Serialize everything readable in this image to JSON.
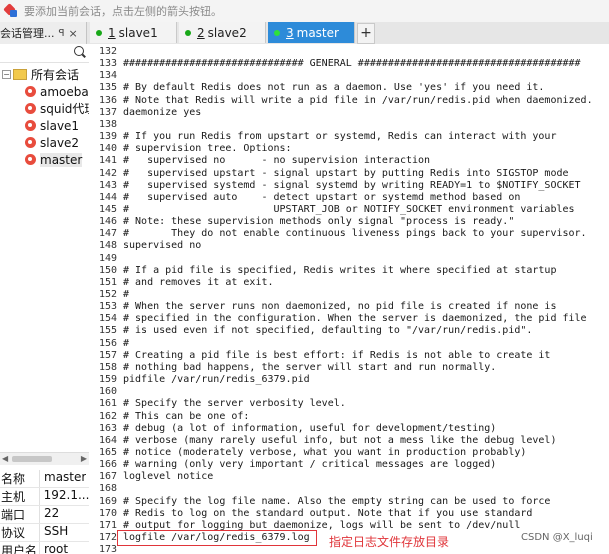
{
  "topbar": {
    "hint": "要添加当前会话，点击左侧的箭头按钮。"
  },
  "panel": {
    "title": "会话管理...",
    "pin": "ꟼ",
    "close": "×"
  },
  "tabs": [
    {
      "num": "1",
      "label": "slave1"
    },
    {
      "num": "2",
      "label": "slave2"
    },
    {
      "num": "3",
      "label": "master"
    }
  ],
  "tab_add": "+",
  "sidebar": {
    "root": "所有会话",
    "sessions": [
      "amoeba",
      "squid代理",
      "slave1",
      "slave2",
      "master"
    ]
  },
  "properties": [
    {
      "k": "名称",
      "v": "master"
    },
    {
      "k": "主机",
      "v": "192.1..."
    },
    {
      "k": "端口",
      "v": "22"
    },
    {
      "k": "协议",
      "v": "SSH"
    },
    {
      "k": "用户名",
      "v": "root"
    }
  ],
  "editor": {
    "lines": [
      {
        "n": "132",
        "t": ""
      },
      {
        "n": "133",
        "t": "############################## GENERAL #####################################"
      },
      {
        "n": "134",
        "t": ""
      },
      {
        "n": "135",
        "t": "# By default Redis does not run as a daemon. Use 'yes' if you need it."
      },
      {
        "n": "136",
        "t": "# Note that Redis will write a pid file in /var/run/redis.pid when daemonized."
      },
      {
        "n": "137",
        "t": "daemonize yes"
      },
      {
        "n": "138",
        "t": ""
      },
      {
        "n": "139",
        "t": "# If you run Redis from upstart or systemd, Redis can interact with your"
      },
      {
        "n": "140",
        "t": "# supervision tree. Options:"
      },
      {
        "n": "141",
        "t": "#   supervised no      - no supervision interaction"
      },
      {
        "n": "142",
        "t": "#   supervised upstart - signal upstart by putting Redis into SIGSTOP mode"
      },
      {
        "n": "143",
        "t": "#   supervised systemd - signal systemd by writing READY=1 to $NOTIFY_SOCKET"
      },
      {
        "n": "144",
        "t": "#   supervised auto    - detect upstart or systemd method based on"
      },
      {
        "n": "145",
        "t": "#                        UPSTART_JOB or NOTIFY_SOCKET environment variables"
      },
      {
        "n": "146",
        "t": "# Note: these supervision methods only signal \"process is ready.\""
      },
      {
        "n": "147",
        "t": "#       They do not enable continuous liveness pings back to your supervisor."
      },
      {
        "n": "148",
        "t": "supervised no"
      },
      {
        "n": "149",
        "t": ""
      },
      {
        "n": "150",
        "t": "# If a pid file is specified, Redis writes it where specified at startup"
      },
      {
        "n": "151",
        "t": "# and removes it at exit."
      },
      {
        "n": "152",
        "t": "#"
      },
      {
        "n": "153",
        "t": "# When the server runs non daemonized, no pid file is created if none is"
      },
      {
        "n": "154",
        "t": "# specified in the configuration. When the server is daemonized, the pid file"
      },
      {
        "n": "155",
        "t": "# is used even if not specified, defaulting to \"/var/run/redis.pid\"."
      },
      {
        "n": "156",
        "t": "#"
      },
      {
        "n": "157",
        "t": "# Creating a pid file is best effort: if Redis is not able to create it"
      },
      {
        "n": "158",
        "t": "# nothing bad happens, the server will start and run normally."
      },
      {
        "n": "159",
        "t": "pidfile /var/run/redis_6379.pid"
      },
      {
        "n": "160",
        "t": ""
      },
      {
        "n": "161",
        "t": "# Specify the server verbosity level."
      },
      {
        "n": "162",
        "t": "# This can be one of:"
      },
      {
        "n": "163",
        "t": "# debug (a lot of information, useful for development/testing)"
      },
      {
        "n": "164",
        "t": "# verbose (many rarely useful info, but not a mess like the debug level)"
      },
      {
        "n": "165",
        "t": "# notice (moderately verbose, what you want in production probably)"
      },
      {
        "n": "166",
        "t": "# warning (only very important / critical messages are logged)"
      },
      {
        "n": "167",
        "t": "loglevel notice"
      },
      {
        "n": "168",
        "t": ""
      },
      {
        "n": "169",
        "t": "# Specify the log file name. Also the empty string can be used to force"
      },
      {
        "n": "170",
        "t": "# Redis to log on the standard output. Note that if you use standard"
      },
      {
        "n": "171",
        "t": "# output for logging but daemonize, logs will be sent to /dev/null"
      },
      {
        "n": "172",
        "t": "logfile /var/log/redis_6379.log"
      },
      {
        "n": "173",
        "t": ""
      }
    ]
  },
  "annotation": "指定日志文件存放目录",
  "watermark": "CSDN @X_luqi",
  "colors": {
    "active_tab": "#2d8bd9",
    "status_dot": "#18a818",
    "annotation": "#e0353a"
  }
}
